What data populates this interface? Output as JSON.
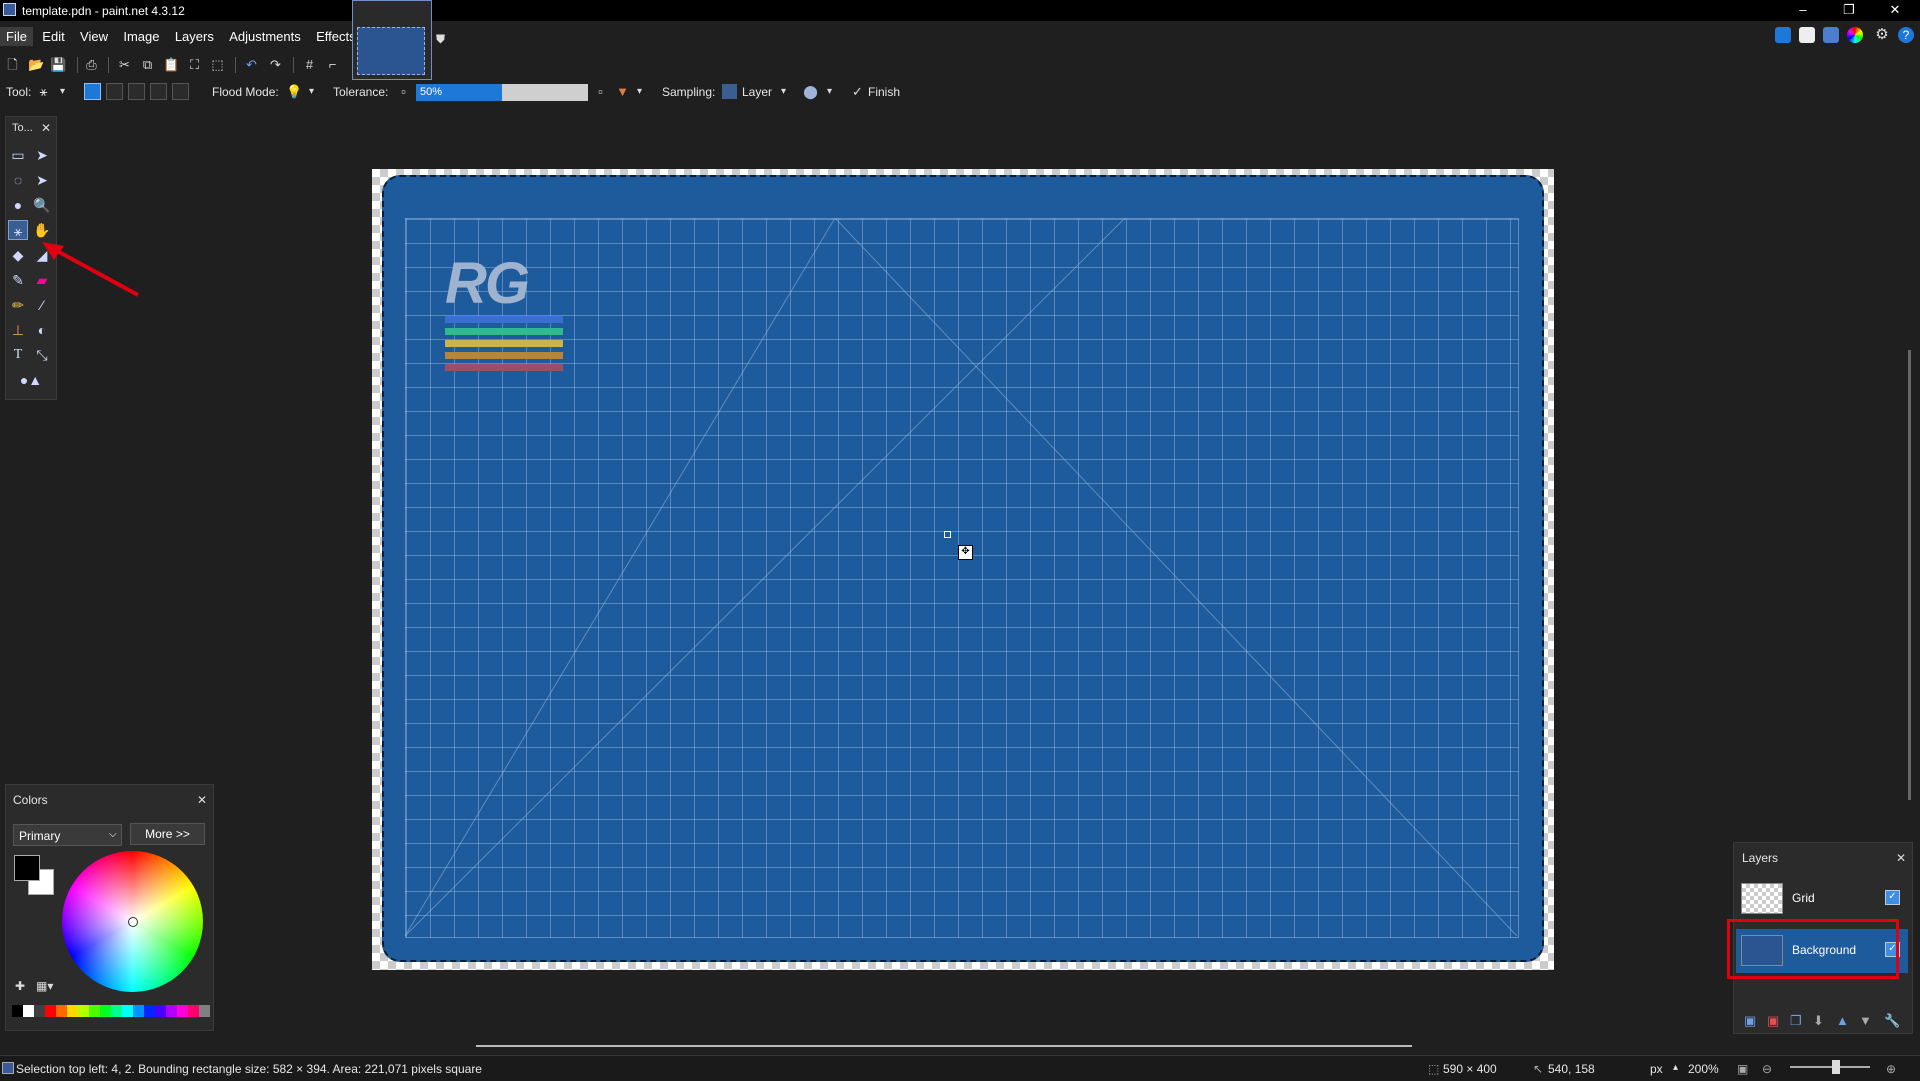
{
  "window": {
    "title": "template.pdn - paint.net 4.3.12",
    "controls": [
      "minimize-icon",
      "restore-icon",
      "close-icon"
    ]
  },
  "menu": {
    "items": [
      "File",
      "Edit",
      "View",
      "Image",
      "Layers",
      "Adjustments",
      "Effects"
    ]
  },
  "toolbar": {
    "tool_label": "Tool:",
    "flood_mode_label": "Flood Mode:",
    "tolerance_label": "Tolerance:",
    "tolerance_value": "50%",
    "tolerance_fraction": 0.5,
    "sampling_label": "Sampling:",
    "sampling_value": "Layer",
    "finish_label": "Finish",
    "icons": [
      "new-icon",
      "open-icon",
      "save-icon",
      "print-icon",
      "cut-icon",
      "copy-icon",
      "paste-icon",
      "crop-icon",
      "deselect-icon",
      "undo-icon",
      "redo-icon",
      "grid-icon",
      "ruler-icon"
    ]
  },
  "tools_panel": {
    "title": "To...",
    "tools": [
      "rectangle-select",
      "move-selection",
      "lasso-select",
      "move-selection-2",
      "ellipse-select",
      "zoom",
      "magic-wand",
      "pan",
      "paint-bucket",
      "gradient",
      "paintbrush",
      "eraser",
      "pencil",
      "color-picker",
      "clone-stamp",
      "recolor",
      "text",
      "line-curve",
      "shapes"
    ]
  },
  "colors_panel": {
    "title": "Colors",
    "mode": "Primary",
    "more_label": "More >>",
    "primary_color": "#000000",
    "secondary_color": "#ffffff",
    "palette": [
      "#000000",
      "#ffffff",
      "#404040",
      "#ff0000",
      "#ff6a00",
      "#ffd800",
      "#b6ff00",
      "#4cff00",
      "#00ff21",
      "#00ff90",
      "#00ffff",
      "#0094ff",
      "#0026ff",
      "#4800ff",
      "#b200ff",
      "#ff00dc",
      "#ff006e",
      "#808080"
    ]
  },
  "canvas": {
    "logo_text": "RG",
    "mat_color": "#1e5b9c",
    "stripes": [
      "#3a6fd1",
      "#2fb98c",
      "#c9b64a",
      "#b7843f",
      "#9b4d6a"
    ]
  },
  "layers_panel": {
    "title": "Layers",
    "layers": [
      {
        "name": "Grid",
        "visible": true,
        "selected": false
      },
      {
        "name": "Background",
        "visible": true,
        "selected": true
      }
    ]
  },
  "status": {
    "selection_info": "Selection top left: 4, 2. Bounding rectangle size: 582 × 394. Area: 221,071 pixels square",
    "image_size": "590 × 400",
    "cursor_pos": "540, 158",
    "units": "px",
    "zoom": "200%"
  },
  "annotations": {
    "highlight_color": "#e0000f"
  }
}
